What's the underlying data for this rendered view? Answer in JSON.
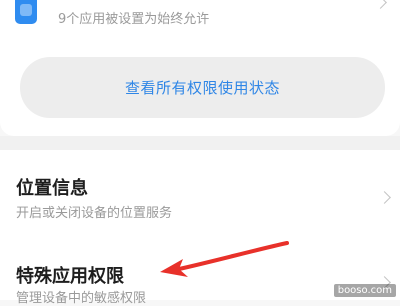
{
  "top_card": {
    "subtitle": "9个应用被设置为始终允许",
    "view_all_button_label": "查看所有权限使用状态"
  },
  "settings_list": [
    {
      "title": "位置信息",
      "subtitle": "开启或关闭设备的位置服务"
    },
    {
      "title": "特殊应用权限",
      "subtitle": "管理设备中的敏感权限"
    }
  ],
  "watermark": "booso.com",
  "colors": {
    "accent": "#2f86e6",
    "arrow": "#e8312a",
    "button_bg": "#ededed"
  },
  "icons": {
    "app_icon": "app-icon",
    "chevron": "chevron-right-icon"
  }
}
